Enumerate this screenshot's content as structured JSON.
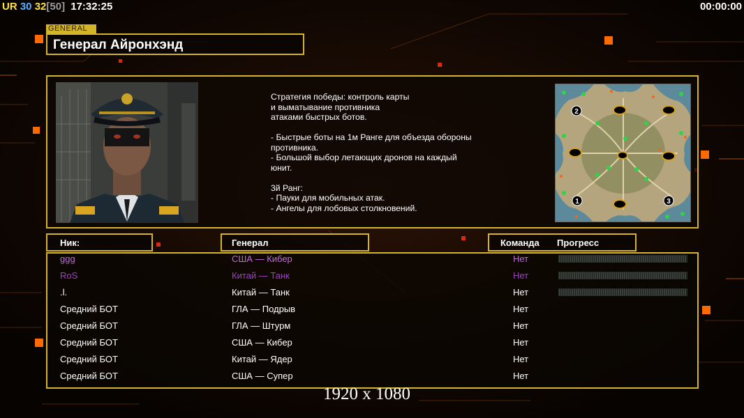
{
  "hud": {
    "ur_label": "UR",
    "value_blue": "30",
    "value_yellow": "32",
    "value_bracket": "[50]",
    "clock": "17:32:25",
    "timer": "00:00:00"
  },
  "general": {
    "tag": "GENERAL",
    "name": "Генерал Айронхэнд",
    "description": "Стратегия победы: контроль карты\nи выматывание противника\nатаками быстрых ботов.\n\n- Быстрые боты на 1м Ранге для объезда обороны\n противника.\n- Большой выбор летающих дронов на каждый\n юнит.\n\n3й Ранг:\n- Пауки для мобильных атак.\n- Ангелы для лобовых столкновений."
  },
  "minimap": {
    "start_labels": [
      "2",
      "1",
      "3"
    ]
  },
  "table": {
    "headers": {
      "nick": "Ник:",
      "general": "Генерал",
      "team": "Команда",
      "progress": "Прогресс"
    },
    "rows": [
      {
        "nick": "ggg",
        "general": "США — Кибер",
        "team": "Нет",
        "color": "#c06ae0",
        "progress": 0
      },
      {
        "nick": "RoS",
        "general": "Китай — Танк",
        "team": "Нет",
        "color": "#a33dd2",
        "progress": 0
      },
      {
        "nick": ".l.",
        "general": "Китай — Танк",
        "team": "Нет",
        "color": "#ffffff",
        "progress": 0
      },
      {
        "nick": "Средний БОТ",
        "general": "ГЛА — Подрыв",
        "team": "Нет",
        "color": "#ffffff"
      },
      {
        "nick": "Средний БОТ",
        "general": "ГЛА — Штурм",
        "team": "Нет",
        "color": "#ffffff"
      },
      {
        "nick": "Средний БОТ",
        "general": "США — Кибер",
        "team": "Нет",
        "color": "#ffffff"
      },
      {
        "nick": "Средний БОТ",
        "general": "Китай — Ядер",
        "team": "Нет",
        "color": "#ffffff"
      },
      {
        "nick": "Средний БОТ",
        "general": "США — Супер",
        "team": "Нет",
        "color": "#ffffff"
      }
    ]
  },
  "resolution": "1920 x 1080",
  "colors": {
    "frame": "#d4b527",
    "accent_orange": "#ff6a00",
    "background": "#0b0502"
  }
}
